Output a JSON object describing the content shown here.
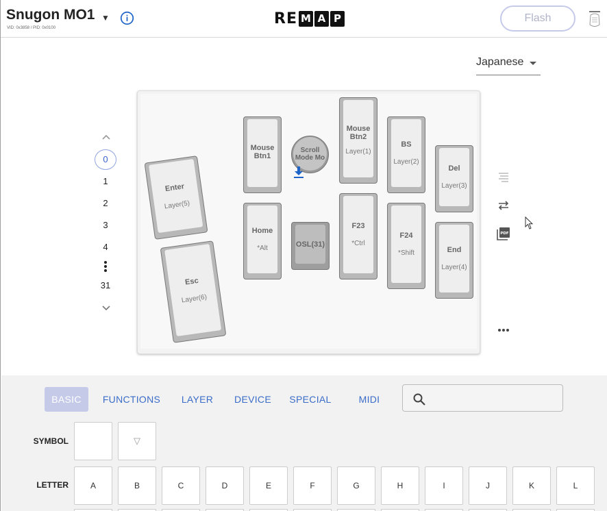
{
  "header": {
    "keyboard_name": "Snugon MO1",
    "ids": "VID: 0x3858 / PID: 0x0100",
    "logo_plain": "RE",
    "logo_boxed": [
      "M",
      "A",
      "P"
    ],
    "flash_label": "Flash"
  },
  "language": {
    "selected": "Japanese"
  },
  "layers": {
    "items": [
      "0",
      "1",
      "2",
      "3",
      "4"
    ],
    "last": "31",
    "selected": "0"
  },
  "keys": {
    "enter": {
      "label": "Enter",
      "hold": "Layer(5)"
    },
    "esc": {
      "label": "Esc",
      "hold": "Layer(6)"
    },
    "mouse1": {
      "label": "Mouse Btn1",
      "hold": ""
    },
    "home": {
      "label": "Home",
      "hold": "*Alt"
    },
    "knob": {
      "label": "Scroll Mode Mo"
    },
    "osl": {
      "label": "OSL(31)"
    },
    "mouse2": {
      "label": "Mouse Btn2",
      "hold": "Layer(1)"
    },
    "f23": {
      "label": "F23",
      "hold": "*Ctrl"
    },
    "bs": {
      "label": "BS",
      "hold": "Layer(2)"
    },
    "f24": {
      "label": "F24",
      "hold": "*Shift"
    },
    "del": {
      "label": "Del",
      "hold": "Layer(3)"
    },
    "end": {
      "label": "End",
      "hold": "Layer(4)"
    }
  },
  "palette": {
    "tabs": [
      "BASIC",
      "FUNCTIONS",
      "LAYER",
      "DEVICE",
      "SPECIAL",
      "MIDI"
    ],
    "active_tab": "BASIC",
    "search_placeholder": "",
    "symbol_label": "SYMBOL",
    "symbol_keys": [
      "",
      "▽"
    ],
    "letter_label": "LETTER",
    "letter_keys": [
      "A",
      "B",
      "C",
      "D",
      "E",
      "F",
      "G",
      "H",
      "I",
      "J",
      "K",
      "L"
    ]
  },
  "icons": {
    "info": "info-icon",
    "lang_caret": "chevron-down-icon",
    "layer_up": "chevron-up-icon",
    "layer_down": "chevron-down-icon",
    "layer_more": "more-vertical-icon",
    "tool1": "text-align-icon",
    "tool2": "swap-icon",
    "tool3": "pdf-icon",
    "tool4": "more-horizontal-icon",
    "search": "search-icon"
  },
  "colors": {
    "accent": "#3a6cc8",
    "active_tab": "#c5cae9",
    "info": "#1e63c8"
  }
}
